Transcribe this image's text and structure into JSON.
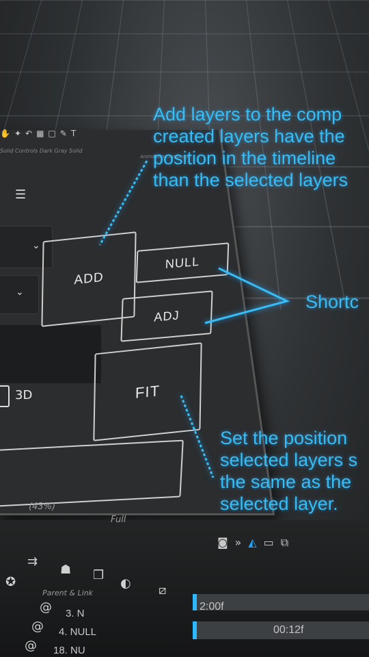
{
  "toolbar": {
    "sub_label": "Solid Controls  Dark Gray Solid",
    "anim_label": "Animation Composer"
  },
  "buttons": {
    "add": "ADD",
    "null": "NULL",
    "adj": "ADJ",
    "fit": "FIT"
  },
  "checkbox_label": "3D",
  "annotations": {
    "add_lines": [
      "Add layers to the comp",
      "created layers have the",
      "position in the timeline",
      "than the selected layers"
    ],
    "shortcut": "Shortc",
    "fit_lines": [
      "Set the position",
      "selected layers s",
      "the same as the",
      "selected layer."
    ]
  },
  "viewer": {
    "zoom": "(43%)",
    "quality": "Full"
  },
  "timeline": {
    "column_header": "Parent & Link",
    "rows": [
      "3. N",
      "4. NULL",
      "18. NU"
    ],
    "time_top": "2:00f",
    "time_bottom": "00:12f"
  },
  "icons": [
    "hand-icon",
    "pin-icon",
    "undo-icon",
    "brush-icon",
    "square-icon",
    "pen-icon",
    "type-icon"
  ],
  "colors": {
    "accent": "#36bdf5",
    "panel": "#2b2d2f"
  }
}
